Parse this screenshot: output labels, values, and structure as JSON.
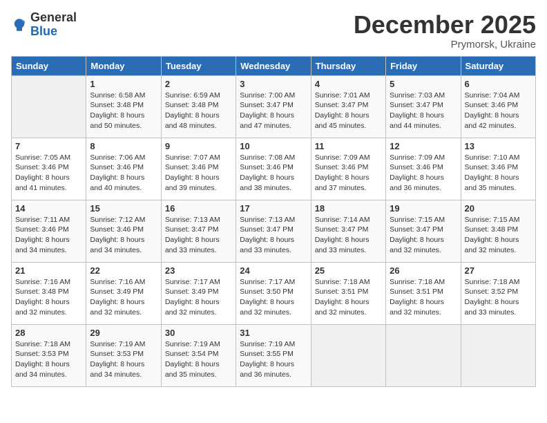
{
  "header": {
    "logo_general": "General",
    "logo_blue": "Blue",
    "month_title": "December 2025",
    "subtitle": "Prymorsk, Ukraine"
  },
  "weekdays": [
    "Sunday",
    "Monday",
    "Tuesday",
    "Wednesday",
    "Thursday",
    "Friday",
    "Saturday"
  ],
  "weeks": [
    [
      {
        "day": "",
        "info": ""
      },
      {
        "day": "1",
        "info": "Sunrise: 6:58 AM\nSunset: 3:48 PM\nDaylight: 8 hours\nand 50 minutes."
      },
      {
        "day": "2",
        "info": "Sunrise: 6:59 AM\nSunset: 3:48 PM\nDaylight: 8 hours\nand 48 minutes."
      },
      {
        "day": "3",
        "info": "Sunrise: 7:00 AM\nSunset: 3:47 PM\nDaylight: 8 hours\nand 47 minutes."
      },
      {
        "day": "4",
        "info": "Sunrise: 7:01 AM\nSunset: 3:47 PM\nDaylight: 8 hours\nand 45 minutes."
      },
      {
        "day": "5",
        "info": "Sunrise: 7:03 AM\nSunset: 3:47 PM\nDaylight: 8 hours\nand 44 minutes."
      },
      {
        "day": "6",
        "info": "Sunrise: 7:04 AM\nSunset: 3:46 PM\nDaylight: 8 hours\nand 42 minutes."
      }
    ],
    [
      {
        "day": "7",
        "info": "Sunrise: 7:05 AM\nSunset: 3:46 PM\nDaylight: 8 hours\nand 41 minutes."
      },
      {
        "day": "8",
        "info": "Sunrise: 7:06 AM\nSunset: 3:46 PM\nDaylight: 8 hours\nand 40 minutes."
      },
      {
        "day": "9",
        "info": "Sunrise: 7:07 AM\nSunset: 3:46 PM\nDaylight: 8 hours\nand 39 minutes."
      },
      {
        "day": "10",
        "info": "Sunrise: 7:08 AM\nSunset: 3:46 PM\nDaylight: 8 hours\nand 38 minutes."
      },
      {
        "day": "11",
        "info": "Sunrise: 7:09 AM\nSunset: 3:46 PM\nDaylight: 8 hours\nand 37 minutes."
      },
      {
        "day": "12",
        "info": "Sunrise: 7:09 AM\nSunset: 3:46 PM\nDaylight: 8 hours\nand 36 minutes."
      },
      {
        "day": "13",
        "info": "Sunrise: 7:10 AM\nSunset: 3:46 PM\nDaylight: 8 hours\nand 35 minutes."
      }
    ],
    [
      {
        "day": "14",
        "info": "Sunrise: 7:11 AM\nSunset: 3:46 PM\nDaylight: 8 hours\nand 34 minutes."
      },
      {
        "day": "15",
        "info": "Sunrise: 7:12 AM\nSunset: 3:46 PM\nDaylight: 8 hours\nand 34 minutes."
      },
      {
        "day": "16",
        "info": "Sunrise: 7:13 AM\nSunset: 3:47 PM\nDaylight: 8 hours\nand 33 minutes."
      },
      {
        "day": "17",
        "info": "Sunrise: 7:13 AM\nSunset: 3:47 PM\nDaylight: 8 hours\nand 33 minutes."
      },
      {
        "day": "18",
        "info": "Sunrise: 7:14 AM\nSunset: 3:47 PM\nDaylight: 8 hours\nand 33 minutes."
      },
      {
        "day": "19",
        "info": "Sunrise: 7:15 AM\nSunset: 3:47 PM\nDaylight: 8 hours\nand 32 minutes."
      },
      {
        "day": "20",
        "info": "Sunrise: 7:15 AM\nSunset: 3:48 PM\nDaylight: 8 hours\nand 32 minutes."
      }
    ],
    [
      {
        "day": "21",
        "info": "Sunrise: 7:16 AM\nSunset: 3:48 PM\nDaylight: 8 hours\nand 32 minutes."
      },
      {
        "day": "22",
        "info": "Sunrise: 7:16 AM\nSunset: 3:49 PM\nDaylight: 8 hours\nand 32 minutes."
      },
      {
        "day": "23",
        "info": "Sunrise: 7:17 AM\nSunset: 3:49 PM\nDaylight: 8 hours\nand 32 minutes."
      },
      {
        "day": "24",
        "info": "Sunrise: 7:17 AM\nSunset: 3:50 PM\nDaylight: 8 hours\nand 32 minutes."
      },
      {
        "day": "25",
        "info": "Sunrise: 7:18 AM\nSunset: 3:51 PM\nDaylight: 8 hours\nand 32 minutes."
      },
      {
        "day": "26",
        "info": "Sunrise: 7:18 AM\nSunset: 3:51 PM\nDaylight: 8 hours\nand 32 minutes."
      },
      {
        "day": "27",
        "info": "Sunrise: 7:18 AM\nSunset: 3:52 PM\nDaylight: 8 hours\nand 33 minutes."
      }
    ],
    [
      {
        "day": "28",
        "info": "Sunrise: 7:18 AM\nSunset: 3:53 PM\nDaylight: 8 hours\nand 34 minutes."
      },
      {
        "day": "29",
        "info": "Sunrise: 7:19 AM\nSunset: 3:53 PM\nDaylight: 8 hours\nand 34 minutes."
      },
      {
        "day": "30",
        "info": "Sunrise: 7:19 AM\nSunset: 3:54 PM\nDaylight: 8 hours\nand 35 minutes."
      },
      {
        "day": "31",
        "info": "Sunrise: 7:19 AM\nSunset: 3:55 PM\nDaylight: 8 hours\nand 36 minutes."
      },
      {
        "day": "",
        "info": ""
      },
      {
        "day": "",
        "info": ""
      },
      {
        "day": "",
        "info": ""
      }
    ]
  ]
}
